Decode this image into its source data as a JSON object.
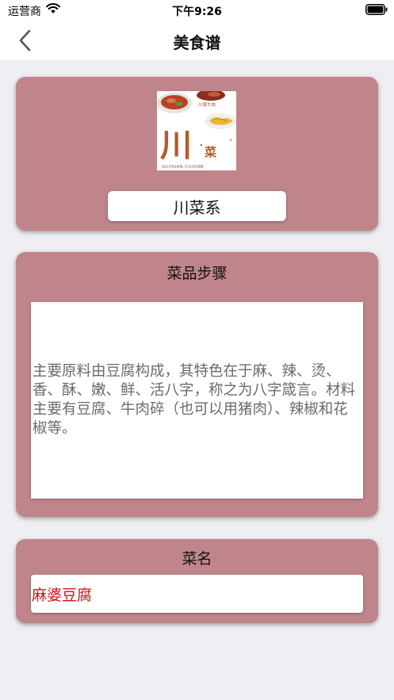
{
  "status_bar": {
    "carrier": "运营商",
    "time": "下午9:26"
  },
  "nav": {
    "title": "美食谱"
  },
  "cuisine": {
    "image_badge": "川菜牛肉",
    "image_big_char": "川",
    "image_small_char": "菜",
    "image_caption": "SICHUAN CUISINE",
    "label": "川菜系"
  },
  "steps": {
    "title": "菜品步骤",
    "text": "主要原料由豆腐构成，其特色在于麻、辣、烫、香、酥、嫩、鲜、活八字，称之为八字箴言。材料主要有豆腐、牛肉碎（也可以用猪肉）、辣椒和花椒等。"
  },
  "dish": {
    "title": "菜名",
    "value": "麻婆豆腐"
  },
  "colors": {
    "card": "#bf858a",
    "dish_text": "#d0101d",
    "background": "#efeef3"
  }
}
